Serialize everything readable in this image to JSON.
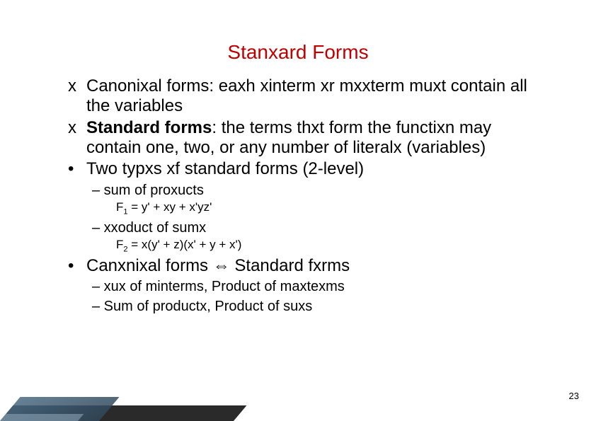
{
  "title": "Stanxard Forms",
  "bullets": [
    {
      "marker": "x",
      "text_pre": "Canonixal forms: eaxh xinterm  xr mxxterm muxt contain all the variables",
      "bold": false
    },
    {
      "marker": "x",
      "text_bold": "Standard forms",
      "text_rest": ": the terms thxt form the functixn may contain one, two, or any number of literalx (variables)"
    },
    {
      "marker": "•",
      "text_pre": "Two typxs  xf standard forms (2-level)"
    }
  ],
  "sub1": [
    {
      "text": "– sum of proxucts"
    },
    {
      "formula": "F",
      "sub": "1",
      "rest": " = y' + xy + x'yz'"
    },
    {
      "text": "– xxoduct of sumx"
    },
    {
      "formula": "F",
      "sub": "2",
      "rest": " = x(y' + z)(x' + y + x')"
    }
  ],
  "bullet4": {
    "marker": "•",
    "left": "Canxnixal forms ",
    "arrow": "⇔",
    "right": " Standard fxrms"
  },
  "sub2": [
    "– xux  of minterms, Product of maxtexms",
    "– Sum of productx, Product of suxs"
  ],
  "page": "23"
}
